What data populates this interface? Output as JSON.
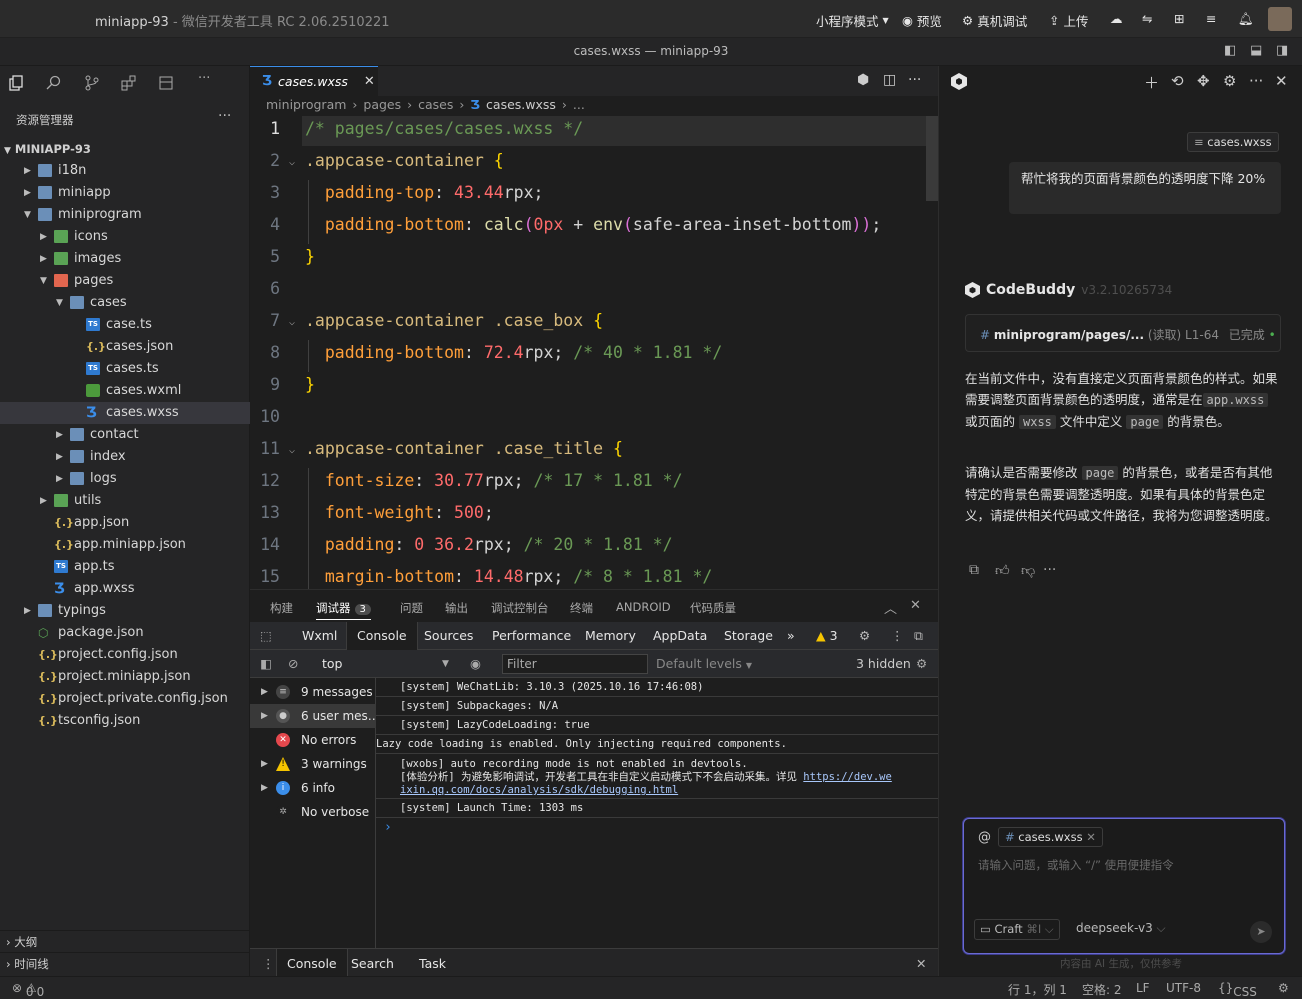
{
  "titlebar": {
    "project": "miniapp-93",
    "app": "- 微信开发者工具 RC 2.06.2510221",
    "mode": "小程序模式",
    "preview": "预览",
    "device_debug": "真机调试",
    "upload": "上传",
    "window_title": "cases.wxss — miniapp-93"
  },
  "sidebar": {
    "header": "资源管理器",
    "project": "MINIAPP-93",
    "tree": [
      {
        "name": "i18n",
        "depth": 1,
        "arrow": "right",
        "icon": "folder"
      },
      {
        "name": "miniapp",
        "depth": 1,
        "arrow": "right",
        "icon": "folder"
      },
      {
        "name": "miniprogram",
        "depth": 1,
        "arrow": "down",
        "icon": "folder"
      },
      {
        "name": "icons",
        "depth": 2,
        "arrow": "right",
        "icon": "folder-green"
      },
      {
        "name": "images",
        "depth": 2,
        "arrow": "right",
        "icon": "folder-green"
      },
      {
        "name": "pages",
        "depth": 2,
        "arrow": "down",
        "icon": "folder-pink"
      },
      {
        "name": "cases",
        "depth": 3,
        "arrow": "down",
        "icon": "folder"
      },
      {
        "name": "case.ts",
        "depth": 4,
        "arrow": "",
        "icon": "ts"
      },
      {
        "name": "cases.json",
        "depth": 4,
        "arrow": "",
        "icon": "json"
      },
      {
        "name": "cases.ts",
        "depth": 4,
        "arrow": "",
        "icon": "ts"
      },
      {
        "name": "cases.wxml",
        "depth": 4,
        "arrow": "",
        "icon": "wxml"
      },
      {
        "name": "cases.wxss",
        "depth": 4,
        "arrow": "",
        "icon": "wxss",
        "selected": true
      },
      {
        "name": "contact",
        "depth": 3,
        "arrow": "right",
        "icon": "folder"
      },
      {
        "name": "index",
        "depth": 3,
        "arrow": "right",
        "icon": "folder"
      },
      {
        "name": "logs",
        "depth": 3,
        "arrow": "right",
        "icon": "folder"
      },
      {
        "name": "utils",
        "depth": 2,
        "arrow": "right",
        "icon": "folder-green"
      },
      {
        "name": "app.json",
        "depth": 2,
        "arrow": "",
        "icon": "json"
      },
      {
        "name": "app.miniapp.json",
        "depth": 2,
        "arrow": "",
        "icon": "json"
      },
      {
        "name": "app.ts",
        "depth": 2,
        "arrow": "",
        "icon": "ts"
      },
      {
        "name": "app.wxss",
        "depth": 2,
        "arrow": "",
        "icon": "wxss"
      },
      {
        "name": "typings",
        "depth": 1,
        "arrow": "right",
        "icon": "folder-blue"
      },
      {
        "name": "package.json",
        "depth": 1,
        "arrow": "",
        "icon": "pkg"
      },
      {
        "name": "project.config.json",
        "depth": 1,
        "arrow": "",
        "icon": "json"
      },
      {
        "name": "project.miniapp.json",
        "depth": 1,
        "arrow": "",
        "icon": "json"
      },
      {
        "name": "project.private.config.json",
        "depth": 1,
        "arrow": "",
        "icon": "json"
      },
      {
        "name": "tsconfig.json",
        "depth": 1,
        "arrow": "",
        "icon": "json"
      }
    ],
    "outline": "大纲",
    "timeline": "时间线"
  },
  "editor": {
    "tab": "cases.wxss",
    "breadcrumbs": [
      "miniprogram",
      "pages",
      "cases",
      "cases.wxss",
      "..."
    ],
    "lines": [
      "/* pages/cases/cases.wxss */",
      ".appcase-container {",
      "  padding-top: 43.44rpx;",
      "  padding-bottom: calc(0px + env(safe-area-inset-bottom));",
      "}",
      "",
      ".appcase-container .case_box {",
      "  padding-bottom: 72.4rpx; /* 40 * 1.81 */",
      "}",
      "",
      ".appcase-container .case_title {",
      "  font-size: 30.77rpx; /* 17 * 1.81 */",
      "  font-weight: 500;",
      "  padding: 0 36.2rpx; /* 20 * 1.81 */",
      "  margin-bottom: 14.48rpx; /* 8 * 1.81 */"
    ]
  },
  "panel": {
    "tabs": [
      "构建",
      "调试器",
      "问题",
      "输出",
      "调试控制台",
      "终端",
      "ANDROID",
      "代码质量"
    ],
    "debugger_badge": "3",
    "devtools_tabs": [
      "Wxml",
      "Console",
      "Sources",
      "Performance",
      "Memory",
      "AppData",
      "Storage"
    ],
    "more": "»",
    "warn_count": "3",
    "context": "top",
    "filter_placeholder": "Filter",
    "levels": "Default levels",
    "hidden": "3 hidden",
    "side": [
      {
        "label": "9 messages",
        "icon": "list",
        "arrow": true
      },
      {
        "label": "6 user mes…",
        "icon": "user",
        "arrow": true,
        "selected": true
      },
      {
        "label": "No errors",
        "icon": "error",
        "arrow": false
      },
      {
        "label": "3 warnings",
        "icon": "warning",
        "arrow": true
      },
      {
        "label": "6 info",
        "icon": "info",
        "arrow": true
      },
      {
        "label": "No verbose",
        "icon": "verbose",
        "arrow": false
      }
    ],
    "logs": [
      "[system] WeChatLib: 3.10.3 (2025.10.16 17:46:08)",
      "[system] Subpackages: N/A",
      "[system] LazyCodeLoading: true",
      "Lazy code loading is enabled. Only injecting required components.",
      "[wxobs] auto recording mode is not enabled in devtools.",
      "[体验分析] 为避免影响调试，开发者工具在非自定义启动模式下不会启动采集。详见 ",
      "[system] Launch Time: 1303 ms"
    ],
    "log_link_1": "https://dev.we",
    "log_link_2": "ixin.qq.com/docs/analysis/sdk/debugging.html",
    "prompt": "›",
    "bottom_tabs": [
      "Console",
      "Search",
      "Task"
    ]
  },
  "chat": {
    "file_chip": "cases.wxss",
    "user_message": "帮忙将我的页面背景颜色的透明度下降 20%",
    "assistant": "CodeBuddy",
    "version": "v3.2.10265734",
    "tool_path": "miniprogram/pages/...",
    "tool_meta": "(读取) L1-64",
    "tool_status": "已完成",
    "answer_p1_a": "在当前文件中，没有直接定义页面背景颜色的样式。如果需要调整页面背景颜色的透明度，通常是在",
    "answer_p1_code1": "app.wxss",
    "answer_p1_b": "或页面的",
    "answer_p1_code2": "wxss",
    "answer_p1_c": "文件中定义",
    "answer_p1_code3": "page",
    "answer_p1_d": "的背景色。",
    "answer_p2_a": "请确认是否需要修改",
    "answer_p2_code": "page",
    "answer_p2_b": "的背景色，或者是否有其他特定的背景色需要调整透明度。如果有具体的背景色定义，请提供相关代码或文件路径，我将为您调整透明度。",
    "input_chip": "cases.wxss",
    "input_placeholder": "请输入问题，或输入 “/” 使用便捷指令",
    "mode": "Craft",
    "mode_shortcut": "⌘I",
    "model": "deepseek-v3",
    "disclaimer": "内容由 AI 生成，仅供参考"
  },
  "status": {
    "problems": "0",
    "warnings": "0",
    "position": "行 1，列 1",
    "spaces": "空格: 2",
    "eol": "LF",
    "encoding": "UTF-8",
    "language": "CSS"
  },
  "colors": {
    "accent": "#3b8eea",
    "selector": "#d7ba7d",
    "property": "#ff9f3a",
    "number": "#ff6b6b",
    "comment": "#6a9955"
  }
}
